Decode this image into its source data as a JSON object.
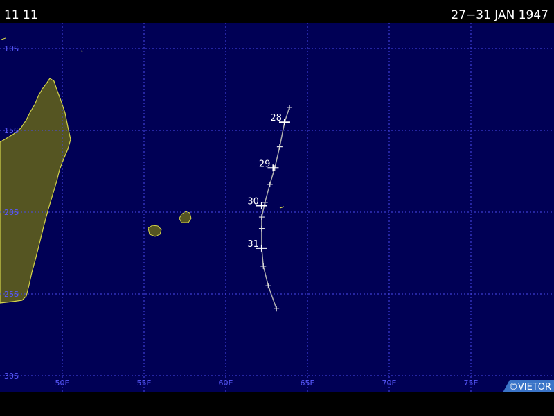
{
  "header": {
    "left": "11 11",
    "right": "27−31 JAN 1947"
  },
  "map": {
    "background_color": "#000055",
    "land_color": "#555522",
    "coast_color": "#d4d44a",
    "grid_color": "#4a4af0",
    "label_color": "#5a5aff",
    "longitudes": [
      {
        "value": 50,
        "label": "50E"
      },
      {
        "value": 55,
        "label": "55E"
      },
      {
        "value": 60,
        "label": "60E"
      },
      {
        "value": 65,
        "label": "65E"
      },
      {
        "value": 70,
        "label": "70E"
      },
      {
        "value": 75,
        "label": "75E"
      }
    ],
    "latitudes": [
      {
        "value": -10,
        "label": "10S"
      },
      {
        "value": -15,
        "label": "15S"
      },
      {
        "value": -20,
        "label": "20S"
      },
      {
        "value": -25,
        "label": "25S"
      },
      {
        "value": -30,
        "label": "30S"
      }
    ]
  },
  "track": {
    "color": "#b0b0b0",
    "points": [
      {
        "lon": 63.9,
        "lat": -13.6
      },
      {
        "lon": 63.6,
        "lat": -14.5
      },
      {
        "lon": 63.3,
        "lat": -16.0
      },
      {
        "lon": 63.0,
        "lat": -17.3
      },
      {
        "lon": 62.7,
        "lat": -18.3
      },
      {
        "lon": 62.4,
        "lat": -19.4
      },
      {
        "lon": 62.2,
        "lat": -20.3
      },
      {
        "lon": 62.2,
        "lat": -21.0
      },
      {
        "lon": 62.2,
        "lat": -22.2
      },
      {
        "lon": 62.3,
        "lat": -23.3
      },
      {
        "lon": 62.6,
        "lat": -24.5
      },
      {
        "lon": 63.1,
        "lat": -25.9
      }
    ],
    "day_markers": [
      {
        "label": "28",
        "lon": 63.6,
        "lat": -14.5
      },
      {
        "label": "29",
        "lon": 62.9,
        "lat": -17.3
      },
      {
        "label": "30",
        "lon": 62.2,
        "lat": -19.6
      },
      {
        "label": "31",
        "lon": 62.2,
        "lat": -22.2
      }
    ]
  },
  "copyright": "©VIETOR"
}
